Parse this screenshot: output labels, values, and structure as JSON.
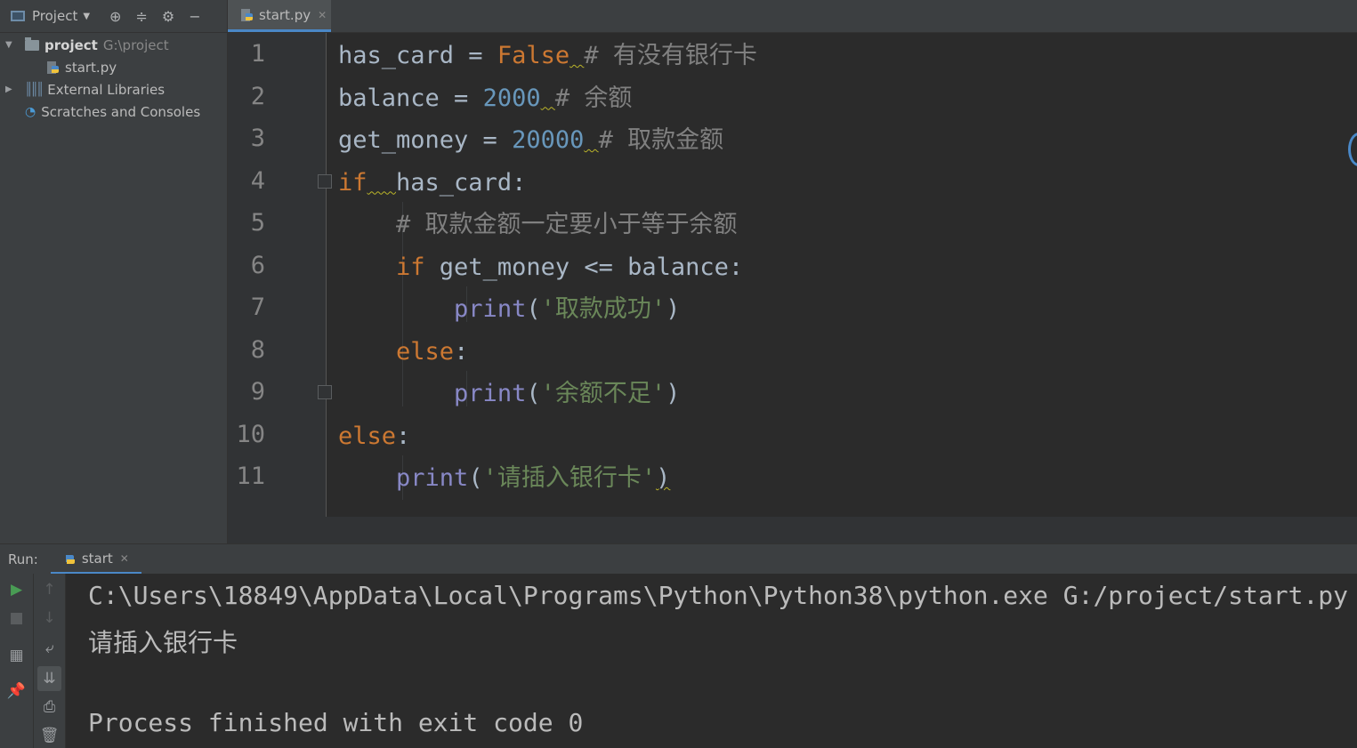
{
  "sidebar": {
    "title": "Project",
    "tree": {
      "root_name": "project",
      "root_path": "G:\\project",
      "file": "start.py",
      "external": "External Libraries",
      "scratches": "Scratches and Consoles"
    }
  },
  "editor": {
    "tab": "start.py",
    "lines": [
      {
        "num": "1",
        "parts": [
          [
            "has_card = ",
            ""
          ],
          [
            "False",
            "kw"
          ],
          [
            " ",
            "squig"
          ],
          [
            "# 有没有银行卡",
            "cmt"
          ]
        ]
      },
      {
        "num": "2",
        "parts": [
          [
            "balance = ",
            ""
          ],
          [
            "2000",
            "num"
          ],
          [
            " ",
            "squig"
          ],
          [
            "# 余额",
            "cmt"
          ]
        ]
      },
      {
        "num": "3",
        "parts": [
          [
            "get_money = ",
            ""
          ],
          [
            "20000",
            "num"
          ],
          [
            " ",
            "squig"
          ],
          [
            "# 取款金额",
            "cmt"
          ]
        ]
      },
      {
        "num": "4",
        "parts": [
          [
            "if",
            "kw"
          ],
          [
            "  ",
            "squig"
          ],
          [
            "has_card:",
            ""
          ]
        ]
      },
      {
        "num": "5",
        "parts": [
          [
            "    ",
            ""
          ],
          [
            "# 取款金额一定要小于等于余额",
            "cmt"
          ]
        ]
      },
      {
        "num": "6",
        "parts": [
          [
            "    ",
            ""
          ],
          [
            "if",
            "kw"
          ],
          [
            " get_money <= balance:",
            ""
          ]
        ]
      },
      {
        "num": "7",
        "parts": [
          [
            "        ",
            ""
          ],
          [
            "print",
            "fn"
          ],
          [
            "(",
            ""
          ],
          [
            "'取款成功'",
            "str"
          ],
          [
            ")",
            ""
          ]
        ]
      },
      {
        "num": "8",
        "parts": [
          [
            "    ",
            ""
          ],
          [
            "else",
            "kw"
          ],
          [
            ":",
            ""
          ]
        ]
      },
      {
        "num": "9",
        "parts": [
          [
            "        ",
            ""
          ],
          [
            "print",
            "fn"
          ],
          [
            "(",
            ""
          ],
          [
            "'余额不足'",
            "str"
          ],
          [
            ")",
            ""
          ]
        ]
      },
      {
        "num": "10",
        "parts": [
          [
            "else",
            "kw"
          ],
          [
            ":",
            ""
          ]
        ]
      },
      {
        "num": "11",
        "parts": [
          [
            "    ",
            ""
          ],
          [
            "print",
            "fn"
          ],
          [
            "(",
            ""
          ],
          [
            "'请插入银行卡'",
            "str"
          ],
          [
            ")",
            "squig"
          ]
        ]
      }
    ]
  },
  "run": {
    "label": "Run:",
    "tab": "start",
    "output": [
      "C:\\Users\\18849\\AppData\\Local\\Programs\\Python\\Python38\\python.exe G:/project/start.py",
      "请插入银行卡",
      "",
      "Process finished with exit code 0"
    ]
  },
  "icons": [
    "project-icon",
    "locate-icon",
    "collapse-icon",
    "gear-icon",
    "minimize-icon",
    "python-file-icon",
    "folder-icon",
    "libraries-icon",
    "scratches-icon",
    "run-icon",
    "stop-icon",
    "up-arrow-icon",
    "down-arrow-icon",
    "soft-wrap-icon",
    "scroll-to-end-icon",
    "print-icon",
    "trash-icon",
    "layout-icon",
    "pin-icon"
  ]
}
